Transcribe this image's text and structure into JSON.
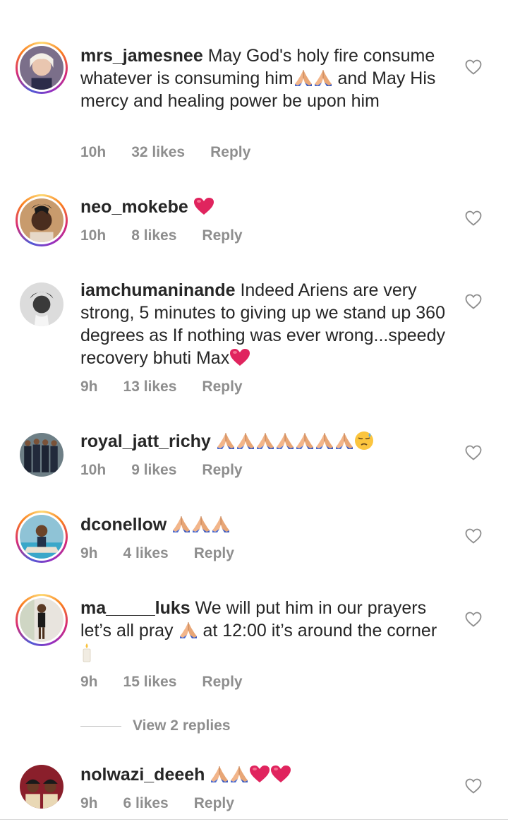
{
  "comments": [
    {
      "username": "mrs_jamesnee",
      "text_a": "May God's holy fire",
      "text_b": "consume whatever is consuming him",
      "text_c": "and May His mercy and healing power be upon him",
      "time": "10h",
      "likes": "32 likes",
      "reply": "Reply",
      "avatar_ring": true
    },
    {
      "username": "neo_mokebe",
      "time": "10h",
      "likes": "8 likes",
      "reply": "Reply",
      "avatar_ring": true
    },
    {
      "username": "iamchumaninande",
      "text_a": "Indeed Ariens are very strong,  5 minutes  to giving up we stand up 360 degrees as If nothing was ever wrong...speedy recovery bhuti Max",
      "time": "9h",
      "likes": "13 likes",
      "reply": "Reply",
      "avatar_ring": false
    },
    {
      "username": "royal_jatt_richy",
      "time": "10h",
      "likes": "9 likes",
      "reply": "Reply",
      "avatar_ring": false
    },
    {
      "username": "dconellow",
      "time": "9h",
      "likes": "4 likes",
      "reply": "Reply",
      "avatar_ring": true
    },
    {
      "username": "ma_____luks",
      "text_a": "We will put him in our prayers let’s all pray",
      "text_b": "at 12:00 it’s around the corner",
      "time": "9h",
      "likes": "15 likes",
      "reply": "Reply",
      "avatar_ring": true
    },
    {
      "username": "nolwazi_deeeh",
      "time": "9h",
      "likes": "6 likes",
      "reply": "Reply",
      "avatar_ring": false
    }
  ],
  "view_replies": "View 2 replies",
  "colors": {
    "text": "#262626",
    "meta": "#8e8e8e",
    "heart_outline": "#8e8e8e",
    "red_heart": "#e0245e"
  },
  "icons": [
    "heart-outline-icon",
    "praying-hands-emoji",
    "red-heart-emoji",
    "sad-sweat-face-emoji",
    "candle-emoji"
  ]
}
